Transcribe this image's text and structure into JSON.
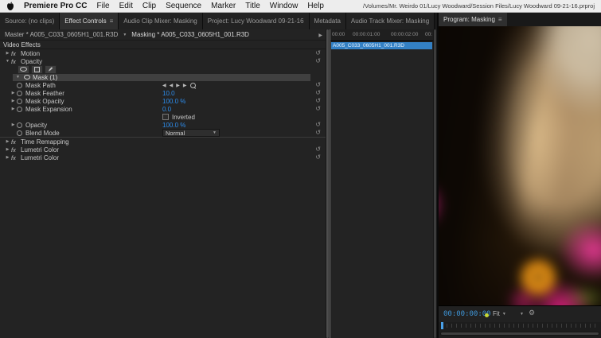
{
  "menubar": {
    "app_name": "Premiere Pro CC",
    "items": [
      "File",
      "Edit",
      "Clip",
      "Sequence",
      "Marker",
      "Title",
      "Window",
      "Help"
    ],
    "document_path": "/Volumes/Mr. Weirdo 01/Lucy Woodward/Session Files/Lucy Woodward 09-21-16.prproj"
  },
  "tabs": {
    "source": "Source: (no clips)",
    "effect_controls": "Effect Controls",
    "audio_clip_mixer": "Audio Clip Mixer: Masking",
    "project": "Project: Lucy Woodward 09-21-16",
    "metadata": "Metadata",
    "audio_track_mixer": "Audio Track Mixer: Masking",
    "program": "Program: Masking"
  },
  "effect_controls": {
    "master_clip": "Master * A005_C033_0605H1_001.R3D",
    "sequence_clip": "Masking * A005_C033_0605H1_001.R3D",
    "video_effects_header": "Video Effects",
    "fx_badge": "fx",
    "motion_label": "Motion",
    "opacity_label": "Opacity",
    "mask_group_label": "Mask (1)",
    "mask_path_label": "Mask Path",
    "mask_feather_label": "Mask Feather",
    "mask_feather_value": "10.0",
    "mask_opacity_label": "Mask Opacity",
    "mask_opacity_value": "100.0 %",
    "mask_expansion_label": "Mask Expansion",
    "mask_expansion_value": "0.0",
    "inverted_label": "Inverted",
    "opacity_param_label": "Opacity",
    "opacity_param_value": "100.0 %",
    "blend_mode_label": "Blend Mode",
    "blend_mode_value": "Normal",
    "time_remapping_label": "Time Remapping",
    "lumetri_1_label": "Lumetri Color",
    "lumetri_2_label": "Lumetri Color"
  },
  "ec_timeline": {
    "ruler_labels": [
      "00:00",
      "00:00:01:00",
      "00:00:02:00",
      "00:"
    ],
    "clip_name": "A005_C033_0605H1_001.R3D"
  },
  "program": {
    "timecode": "00:00:00:00",
    "fit_label": "Fit"
  },
  "colors": {
    "value_text": "#2d8ceb",
    "selected_clip": "#3380c4",
    "timecode": "#3f96d8"
  }
}
